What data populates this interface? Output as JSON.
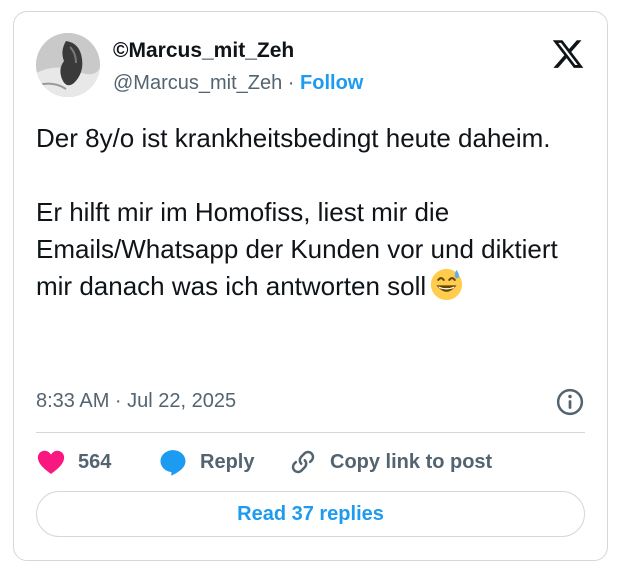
{
  "author": {
    "display_name": "©Marcus_mit_Zeh",
    "handle": "@Marcus_mit_Zeh",
    "separator": " · ",
    "follow_label": "Follow"
  },
  "tweet": {
    "text": "Der 8y/o ist krankheitsbedingt heute daheim.\n\nEr hilft mir im Homofiss, liest mir die Emails/Whatsapp der Kunden vor und diktiert mir danach was ich antworten soll",
    "emoji": "grinning-face-with-sweat",
    "timestamp": "8:33 AM · Jul 22, 2025"
  },
  "actions": {
    "like_count": "564",
    "reply_label": "Reply",
    "copy_link_label": "Copy link to post"
  },
  "read_replies_label": "Read 37 replies",
  "icons": [
    "x-logo",
    "heart-icon",
    "reply-bubble-icon",
    "link-icon",
    "info-icon"
  ],
  "colors": {
    "accent": "#1d9bf0",
    "heart": "#f91880",
    "text": "#0f1419",
    "secondary": "#536471",
    "border": "#cfd9de"
  }
}
